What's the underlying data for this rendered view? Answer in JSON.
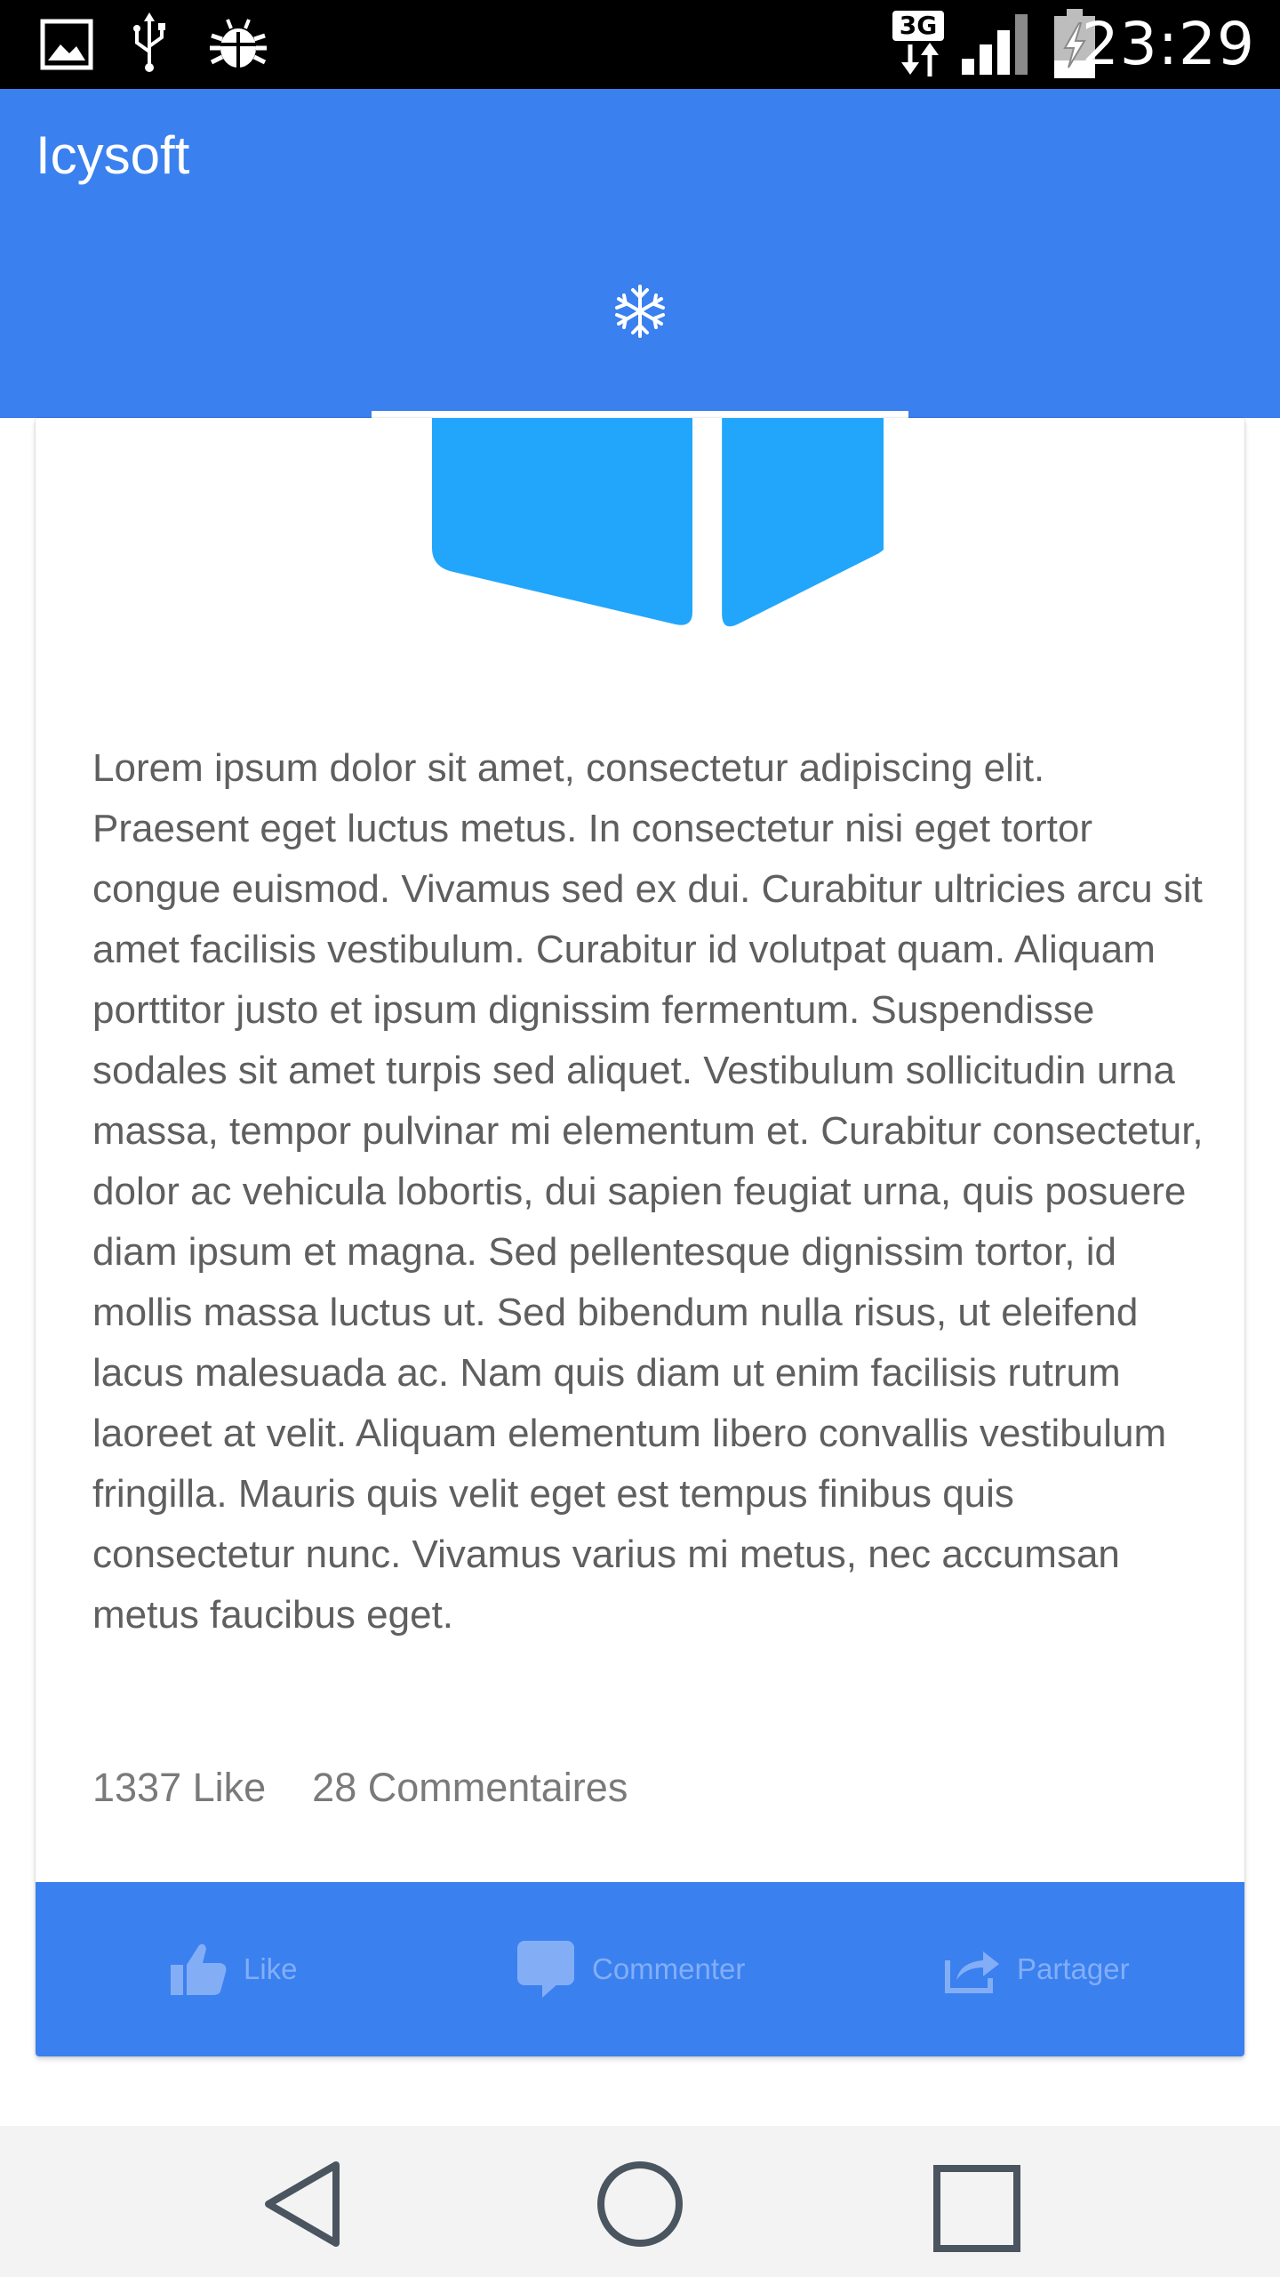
{
  "status_bar": {
    "time": "23:29",
    "network_type": "3G",
    "icons": [
      "image-icon",
      "usb-icon",
      "debug-bug-icon",
      "network-3g-icon",
      "signal-icon",
      "battery-charging-icon"
    ]
  },
  "app_bar": {
    "title": "Icysoft",
    "tab_icon": "snowflake-icon"
  },
  "post": {
    "body": "Lorem ipsum dolor sit amet, consectetur adipiscing elit. Praesent eget luctus metus. In consectetur nisi eget tortor congue euismod. Vivamus sed ex dui. Curabitur ultricies arcu sit amet facilisis vestibulum. Curabitur id volutpat quam. Aliquam porttitor justo et ipsum dignissim fermentum. Suspendisse sodales sit amet turpis sed aliquet. Vestibulum sollicitudin urna massa, tempor pulvinar mi elementum et. Curabitur consectetur, dolor ac vehicula lobortis, dui sapien feugiat urna, quis posuere diam ipsum et magna. Sed pellentesque dignissim tortor, id mollis massa luctus ut. Sed bibendum nulla risus, ut eleifend lacus malesuada ac. Nam quis diam ut enim facilisis rutrum laoreet at velit. Aliquam elementum libero convallis vestibulum fringilla. Mauris quis velit eget est tempus finibus quis consectetur nunc. Vivamus varius mi metus, nec accumsan metus faucibus eget.",
    "likes": "1337 Like",
    "comments": "28 Commentaires"
  },
  "actions": {
    "like_label": "Like",
    "comment_label": "Commenter",
    "share_label": "Partager"
  },
  "colors": {
    "primary": "#3a80ef",
    "logo": "#22a6fb",
    "action_text": "#83aef6"
  },
  "nav_bar": {
    "icons": [
      "back-icon",
      "home-icon",
      "recents-icon"
    ]
  }
}
